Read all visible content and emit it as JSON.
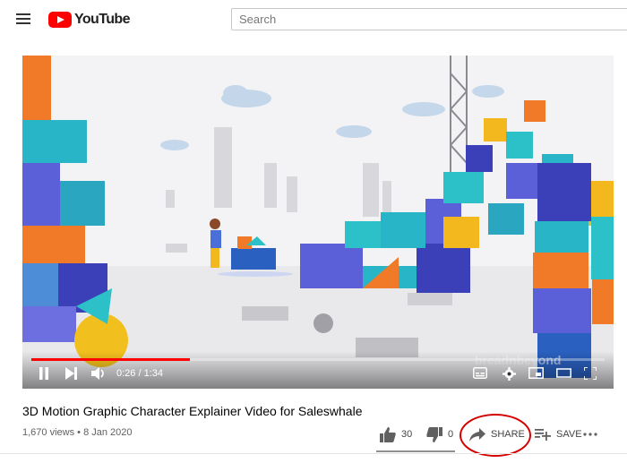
{
  "header": {
    "logo_text": "YouTube",
    "search_placeholder": "Search"
  },
  "player": {
    "time": "0:26 / 1:34",
    "progress_fraction": 0.277,
    "watermark": "breadnbeyond"
  },
  "video": {
    "title": "3D Motion Graphic Character Explainer Video for Saleswhale",
    "views": "1,670 views",
    "date": "8 Jan 2020",
    "meta_separator": "•"
  },
  "actions": {
    "like_count": "30",
    "dislike_count": "0",
    "share_label": "SHARE",
    "save_label": "SAVE"
  },
  "colors": {
    "brand": "#ff0000",
    "annotation_circle": "#d40000"
  }
}
